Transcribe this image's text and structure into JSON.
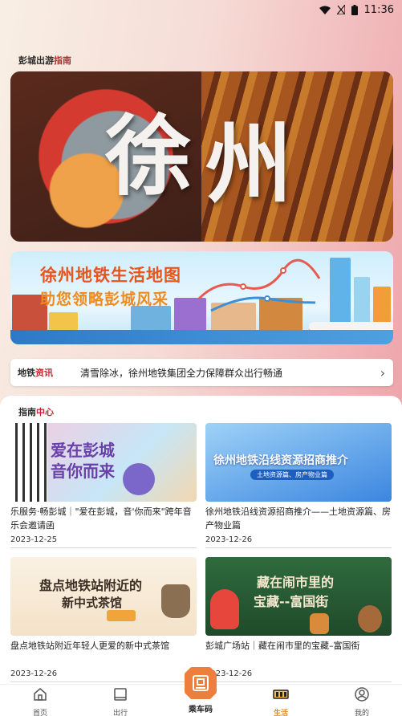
{
  "status_bar": {
    "time": "11:36"
  },
  "sections": {
    "guide_title_prefix": "彭城出游",
    "guide_title_highlight": "指南",
    "center_title_prefix": "指南",
    "center_title_highlight": "中心"
  },
  "hero": {
    "char_1": "徐",
    "char_2": "州"
  },
  "banner": {
    "title": "徐州地铁生活地图",
    "subtitle": "助您领略彭城风采"
  },
  "notice": {
    "label_prefix": "地铁",
    "label_highlight": "资讯",
    "text": "清雪除冰，徐州地铁集团全力保障群众出行畅通"
  },
  "cards": [
    {
      "image_text_1": "爱在彭城",
      "image_text_2": "音你而来",
      "title": "乐服务·畅彭城｜\"爱在彭城，音'你而来\"跨年音乐会邀请函",
      "date": "2023-12-25"
    },
    {
      "image_text_1": "徐州地铁沿线资源招商推介",
      "image_text_2": "土地资源篇、房产物业篇",
      "title": "徐州地铁沿线资源招商推介——土地资源篇、房产物业篇",
      "date": "2023-12-26"
    },
    {
      "image_text_1": "盘点地铁站附近的",
      "image_text_2": "新中式茶馆",
      "title": "盘点地铁站附近年轻人更爱的新中式茶馆",
      "date": "2023-12-26"
    },
    {
      "image_text_1": "藏在闹市里的",
      "image_text_2": "宝藏--富国街",
      "title": "彭城广场站｜藏在闹市里的宝藏–富国街",
      "date": "2023-12-26"
    }
  ],
  "tabbar": {
    "home": "首页",
    "travel": "出行",
    "ride_code": "乘车码",
    "life": "生活",
    "mine": "我的"
  },
  "colors": {
    "accent_orange": "#e58b1d",
    "highlight_red": "#c0282d",
    "center_button": "#ee7e3b"
  }
}
